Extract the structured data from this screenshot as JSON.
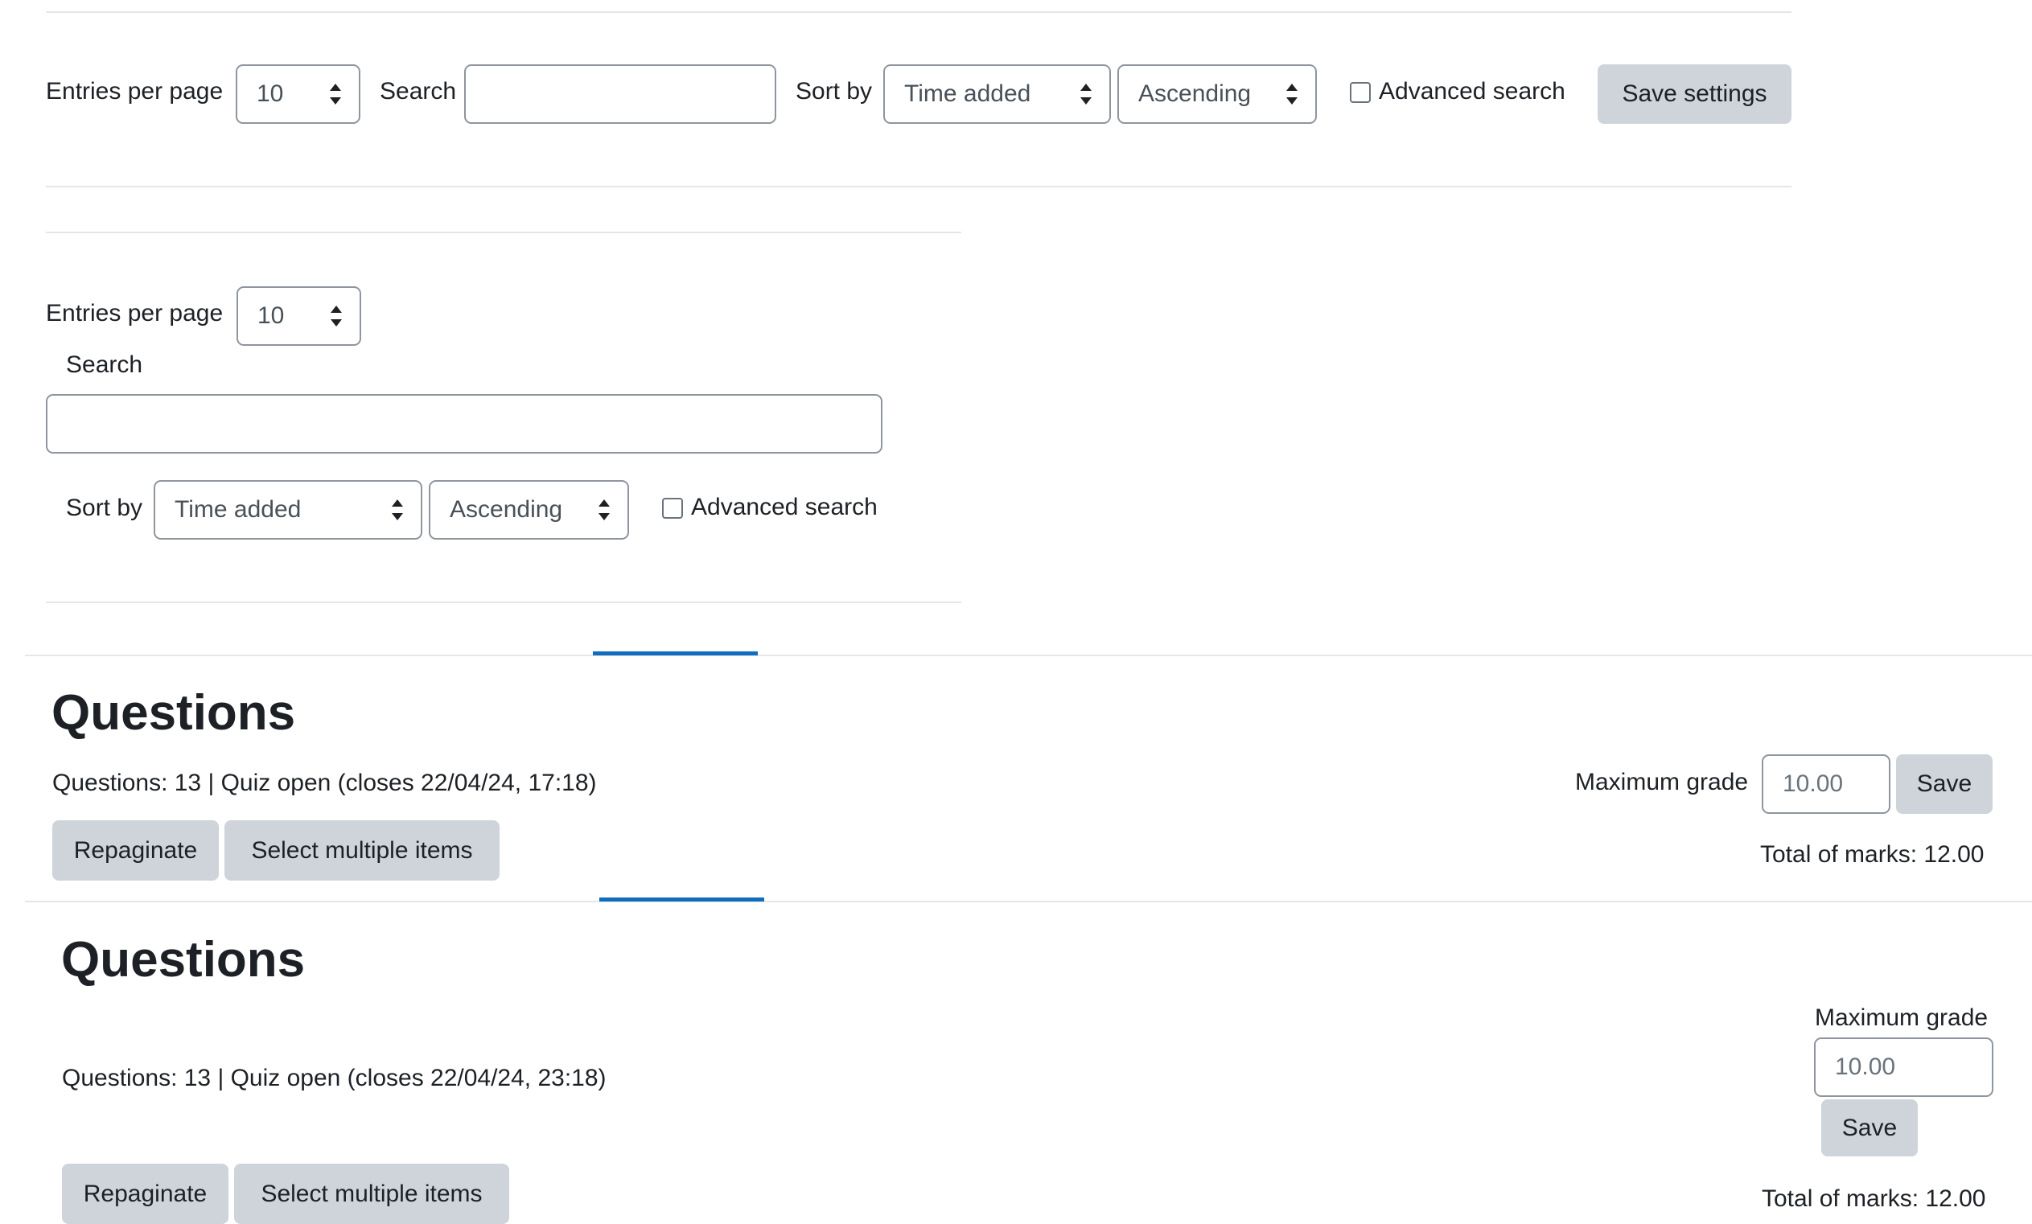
{
  "filters_wide": {
    "entries_label": "Entries per page",
    "entries_value": "10",
    "search_label": "Search",
    "search_value": "",
    "sort_label": "Sort by",
    "sort_field": "Time added",
    "sort_order": "Ascending",
    "advanced_label": "Advanced search",
    "save_label": "Save settings"
  },
  "filters_narrow": {
    "entries_label": "Entries per page",
    "entries_value": "10",
    "search_label": "Search",
    "search_value": "",
    "sort_label": "Sort by",
    "sort_field": "Time added",
    "sort_order": "Ascending",
    "advanced_label": "Advanced search"
  },
  "questions_wide": {
    "heading": "Questions",
    "info": "Questions: 13 | Quiz open (closes 22/04/24, 17:18)",
    "max_grade_label": "Maximum grade",
    "max_grade_value": "10.00",
    "save_label": "Save",
    "repaginate_label": "Repaginate",
    "select_multiple_label": "Select multiple items",
    "total_marks": "Total of marks: 12.00"
  },
  "questions_narrow": {
    "heading": "Questions",
    "info": "Questions: 13 | Quiz open (closes 22/04/24, 23:18)",
    "max_grade_label": "Maximum grade",
    "max_grade_value": "10.00",
    "save_label": "Save",
    "repaginate_label": "Repaginate",
    "select_multiple_label": "Select multiple items",
    "total_marks": "Total of marks: 12.00"
  },
  "colors": {
    "accent": "#0f6cbf",
    "button_bg": "#ced4da",
    "border": "#8f959e",
    "divider": "#e4e6e8"
  }
}
